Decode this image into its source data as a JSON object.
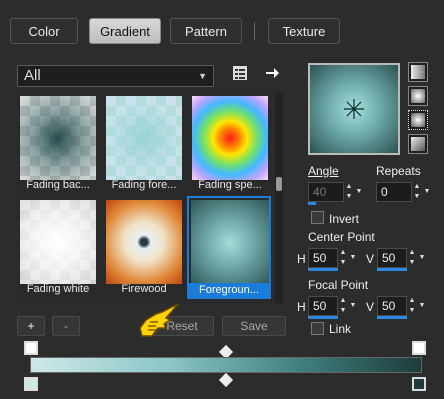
{
  "tabs": [
    {
      "label": "Color",
      "active": false
    },
    {
      "label": "Gradient",
      "active": true
    },
    {
      "label": "Pattern",
      "active": false
    },
    {
      "label": "Texture",
      "active": false
    }
  ],
  "category_dropdown": {
    "value": "All"
  },
  "gradients": [
    {
      "label": "Fading bac..."
    },
    {
      "label": "Fading fore..."
    },
    {
      "label": "Fading spe..."
    },
    {
      "label": "Fading white"
    },
    {
      "label": "Firewood"
    },
    {
      "label": "Foregroun...",
      "selected": true
    }
  ],
  "buttons": {
    "add": "+",
    "remove": "-",
    "reset": "Reset",
    "save": "Save"
  },
  "angle": {
    "label": "Angle",
    "value": "40"
  },
  "repeats": {
    "label": "Repeats",
    "value": "0"
  },
  "invert": {
    "label": "Invert",
    "checked": false
  },
  "center_point": {
    "label": "Center Point",
    "h_label": "H",
    "h": "50",
    "v_label": "V",
    "v": "50"
  },
  "focal_point": {
    "label": "Focal Point",
    "h_label": "H",
    "h": "50",
    "v_label": "V",
    "v": "50"
  },
  "link": {
    "label": "Link",
    "checked": false
  },
  "colors": {
    "accent": "#1d7bd9",
    "gradient_start": "#cfe8e8",
    "gradient_end": "#1d3d3c"
  }
}
